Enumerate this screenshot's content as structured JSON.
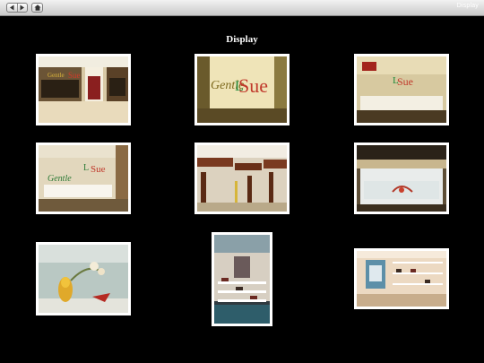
{
  "toolbar": {
    "back_icon": "arrow-left-icon",
    "forward_icon": "arrow-right-icon",
    "home_icon": "home-icon",
    "title": "Display"
  },
  "page": {
    "title": "Display"
  },
  "gallery": {
    "thumbnails": [
      {
        "subject": "store front"
      },
      {
        "subject": "shop sign"
      },
      {
        "subject": "window display"
      },
      {
        "subject": "window display"
      },
      {
        "subject": "display shelves"
      },
      {
        "subject": "display case"
      },
      {
        "subject": "floral display"
      },
      {
        "subject": "shoe shelves"
      },
      {
        "subject": "shoe wall"
      }
    ]
  }
}
